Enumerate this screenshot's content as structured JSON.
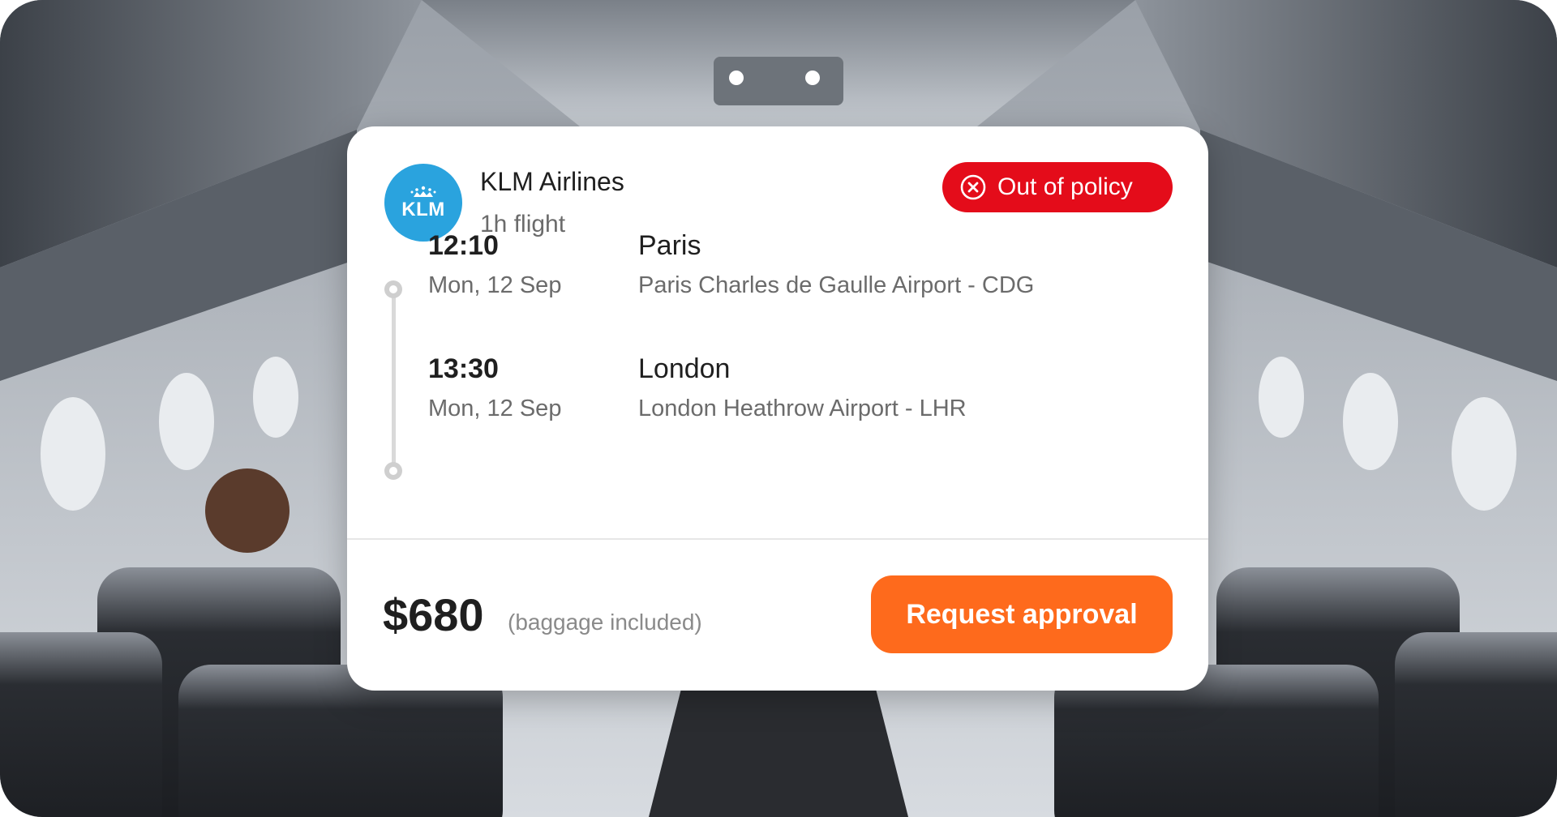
{
  "airline": {
    "logo_text": "KLM",
    "logo_icon": "crown-icon",
    "name": "KLM Airlines",
    "duration": "1h flight"
  },
  "policy_badge": {
    "label": "Out of policy",
    "icon": "x-circle-icon",
    "color": "#e40c1a"
  },
  "departure": {
    "time": "12:10",
    "date": "Mon, 12 Sep",
    "city": "Paris",
    "airport": "Paris Charles de Gaulle Airport - CDG"
  },
  "arrival": {
    "time": "13:30",
    "date": "Mon, 12 Sep",
    "city": "London",
    "airport": "London Heathrow Airport - LHR"
  },
  "pricing": {
    "price": "$680",
    "note": "(baggage included)"
  },
  "action": {
    "label": "Request approval",
    "color": "#fe6a1c"
  },
  "colors": {
    "logo_blue": "#2aa3de"
  }
}
